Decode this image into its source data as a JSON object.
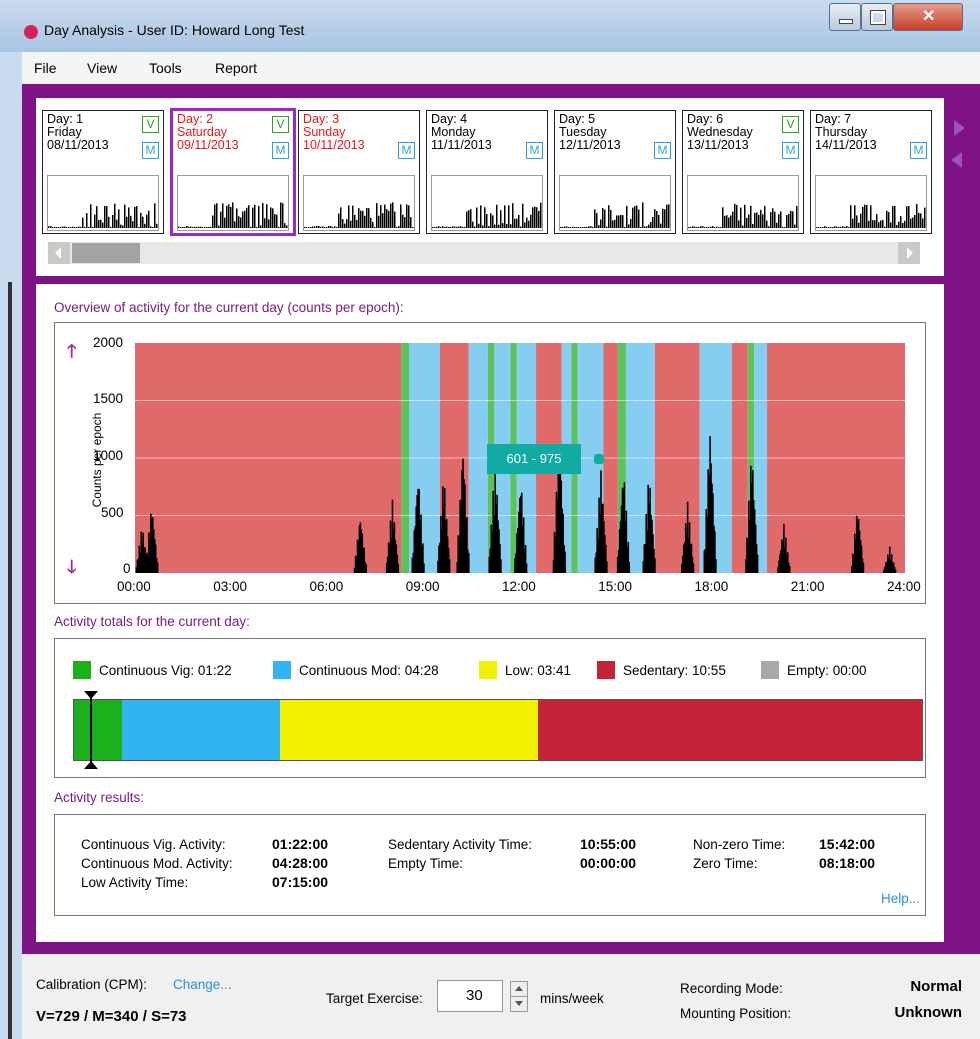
{
  "window": {
    "title": "Day Analysis - User ID: Howard Long Test",
    "icon": "app-icon"
  },
  "menu": [
    "File",
    "View",
    "Tools",
    "Report"
  ],
  "days": [
    {
      "day": "Day: 1",
      "weekday": "Friday",
      "date": "08/11/2013",
      "v": true,
      "m": true,
      "red": false,
      "selected": false
    },
    {
      "day": "Day: 2",
      "weekday": "Saturday",
      "date": "09/11/2013",
      "v": true,
      "m": true,
      "red": true,
      "selected": true
    },
    {
      "day": "Day: 3",
      "weekday": "Sunday",
      "date": "10/11/2013",
      "v": false,
      "m": true,
      "red": true,
      "selected": false
    },
    {
      "day": "Day: 4",
      "weekday": "Monday",
      "date": "11/11/2013",
      "v": false,
      "m": true,
      "red": false,
      "selected": false
    },
    {
      "day": "Day: 5",
      "weekday": "Tuesday",
      "date": "12/11/2013",
      "v": false,
      "m": true,
      "red": false,
      "selected": false
    },
    {
      "day": "Day: 6",
      "weekday": "Wednesday",
      "date": "13/11/2013",
      "v": true,
      "m": true,
      "red": false,
      "selected": false
    },
    {
      "day": "Day: 7",
      "weekday": "Thursday",
      "date": "14/11/2013",
      "v": false,
      "m": true,
      "red": false,
      "selected": false
    }
  ],
  "badges": {
    "v": "V",
    "m": "M"
  },
  "overview": {
    "label": "Overview of activity for the current day (counts per epoch):",
    "ylabel": "Counts per epoch",
    "yticks": [
      "2000",
      "1500",
      "1000",
      "500",
      "0"
    ],
    "xticks": [
      "00:00",
      "03:00",
      "06:00",
      "09:00",
      "12:00",
      "15:00",
      "18:00",
      "21:00",
      "24:00"
    ],
    "tooltip": "601 - 975"
  },
  "chart_data": {
    "type": "bar",
    "title": "Overview of activity for the current day (counts per epoch):",
    "ylabel": "Counts per epoch",
    "xlabel": "",
    "ylim": [
      0,
      2000
    ],
    "xlim_hours": [
      0,
      24
    ],
    "colors": {
      "sedentary": "#e06a6a",
      "moderate": "#86cdf2",
      "vigorous": "#5cc25c",
      "counts": "#000000"
    },
    "band_segments": [
      {
        "from": 0,
        "to": 8.3,
        "kind": "sedentary"
      },
      {
        "from": 8.3,
        "to": 8.55,
        "kind": "vigorous"
      },
      {
        "from": 8.55,
        "to": 9.5,
        "kind": "moderate"
      },
      {
        "from": 9.5,
        "to": 10.4,
        "kind": "sedentary"
      },
      {
        "from": 10.4,
        "to": 11.0,
        "kind": "moderate"
      },
      {
        "from": 11.0,
        "to": 11.2,
        "kind": "vigorous"
      },
      {
        "from": 11.2,
        "to": 11.7,
        "kind": "moderate"
      },
      {
        "from": 11.7,
        "to": 11.9,
        "kind": "vigorous"
      },
      {
        "from": 11.9,
        "to": 12.5,
        "kind": "moderate"
      },
      {
        "from": 12.5,
        "to": 13.3,
        "kind": "sedentary"
      },
      {
        "from": 13.3,
        "to": 13.6,
        "kind": "moderate"
      },
      {
        "from": 13.6,
        "to": 13.8,
        "kind": "vigorous"
      },
      {
        "from": 13.8,
        "to": 14.6,
        "kind": "moderate"
      },
      {
        "from": 14.6,
        "to": 15.05,
        "kind": "sedentary"
      },
      {
        "from": 15.05,
        "to": 15.3,
        "kind": "vigorous"
      },
      {
        "from": 15.3,
        "to": 16.2,
        "kind": "moderate"
      },
      {
        "from": 16.2,
        "to": 17.6,
        "kind": "sedentary"
      },
      {
        "from": 17.6,
        "to": 18.6,
        "kind": "moderate"
      },
      {
        "from": 18.6,
        "to": 19.1,
        "kind": "sedentary"
      },
      {
        "from": 19.1,
        "to": 19.3,
        "kind": "vigorous"
      },
      {
        "from": 19.3,
        "to": 19.7,
        "kind": "moderate"
      },
      {
        "from": 19.7,
        "to": 24,
        "kind": "sedentary"
      }
    ],
    "activity_peaks": [
      {
        "hour": 0.2,
        "count": 420
      },
      {
        "hour": 0.5,
        "count": 620
      },
      {
        "hour": 7.0,
        "count": 520
      },
      {
        "hour": 8.0,
        "count": 640
      },
      {
        "hour": 8.8,
        "count": 900
      },
      {
        "hour": 9.6,
        "count": 880
      },
      {
        "hour": 10.2,
        "count": 1150
      },
      {
        "hour": 11.2,
        "count": 1000
      },
      {
        "hour": 12.0,
        "count": 850
      },
      {
        "hour": 13.2,
        "count": 1250
      },
      {
        "hour": 14.5,
        "count": 920
      },
      {
        "hour": 15.2,
        "count": 950
      },
      {
        "hour": 16.0,
        "count": 900
      },
      {
        "hour": 17.2,
        "count": 620
      },
      {
        "hour": 17.9,
        "count": 1300
      },
      {
        "hour": 19.2,
        "count": 1100
      },
      {
        "hour": 20.2,
        "count": 430
      },
      {
        "hour": 22.5,
        "count": 600
      },
      {
        "hour": 23.5,
        "count": 230
      }
    ]
  },
  "totals": {
    "label": "Activity totals for the current day:",
    "legend": [
      {
        "text": "Continuous Vig: 01:22",
        "color": "#1db01d"
      },
      {
        "text": "Continuous Mod: 04:28",
        "color": "#31b4f0"
      },
      {
        "text": "Low: 03:41",
        "color": "#f2f200"
      },
      {
        "text": "Sedentary: 10:55",
        "color": "#c4233a"
      },
      {
        "text": "Empty: 00:00",
        "color": "#a8a8a8"
      }
    ],
    "bar_fractions": [
      0.057,
      0.186,
      0.304,
      0.453,
      0.0
    ]
  },
  "results": {
    "label": "Activity results:",
    "rows": [
      {
        "label": "Continuous Vig. Activity:",
        "value": "01:22:00"
      },
      {
        "label": "Continuous Mod. Activity:",
        "value": "04:28:00"
      },
      {
        "label": "Low Activity Time:",
        "value": "07:15:00"
      },
      {
        "label": "Sedentary Activity Time:",
        "value": "10:55:00"
      },
      {
        "label": "Empty Time:",
        "value": "00:00:00"
      },
      {
        "label": "Non-zero Time:",
        "value": "15:42:00"
      },
      {
        "label": "Zero Time:",
        "value": "08:18:00"
      }
    ],
    "help": "Help..."
  },
  "footer": {
    "calibration_label": "Calibration (CPM):",
    "change": "Change...",
    "calibration_value": "V=729 / M=340 / S=73",
    "target_label": "Target Exercise:",
    "target_value": "30",
    "target_unit": "mins/week",
    "recording_label": "Recording Mode:",
    "recording_value": "Normal",
    "mounting_label": "Mounting Position:",
    "mounting_value": "Unknown"
  }
}
